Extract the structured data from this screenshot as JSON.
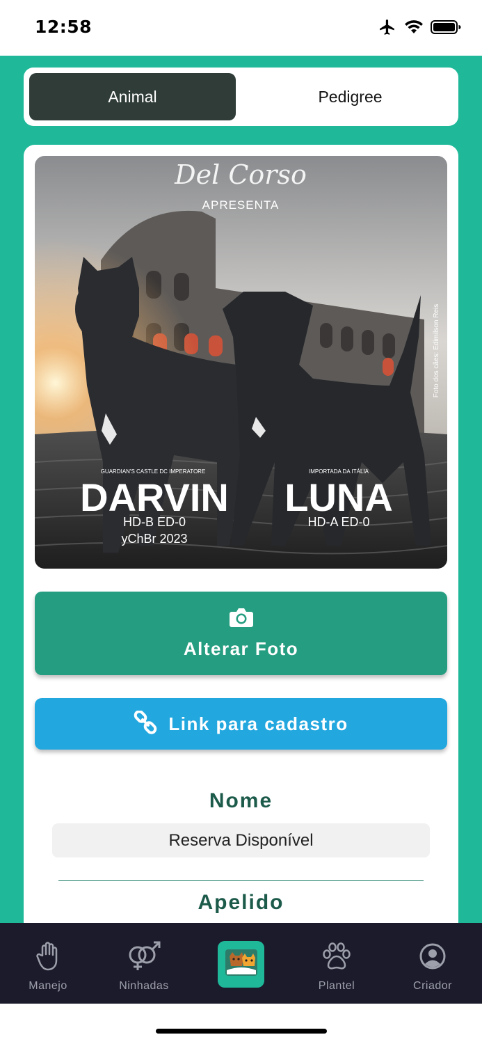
{
  "status_bar": {
    "time": "12:58",
    "icons": [
      "airplane-icon",
      "wifi-icon",
      "battery-icon"
    ]
  },
  "tabs": {
    "items": [
      {
        "label": "Animal",
        "active": true
      },
      {
        "label": "Pedigree",
        "active": false
      }
    ]
  },
  "photo": {
    "header_text": "Del Corso",
    "subheader": "APRESENTA",
    "credit": "Foto dos cães: Edimilson Reis",
    "dog_left": {
      "kennel": "GUARDIAN'S CASTLE DC IMPERATORE",
      "name": "DARVIN",
      "info_1": "HD-B  ED-0",
      "info_2": "yChBr 2023"
    },
    "dog_right": {
      "origin": "IMPORTADA DA ITÁLIA",
      "name": "LUNA",
      "info_1": "HD-A  ED-0"
    }
  },
  "actions": {
    "change_photo_label": "Alterar Foto",
    "change_photo_icon": "camera-icon",
    "link_label": "Link para cadastro",
    "link_icon": "link-icon"
  },
  "form": {
    "name_label": "Nome",
    "name_value": "Reserva Disponível",
    "nickname_label": "Apelido"
  },
  "bottom_nav": {
    "items": [
      {
        "label": "Manejo",
        "icon": "hand-icon"
      },
      {
        "label": "Ninhadas",
        "icon": "gender-icon"
      },
      {
        "label": "",
        "icon": "pets-app-icon",
        "active": true
      },
      {
        "label": "Plantel",
        "icon": "paw-icon"
      },
      {
        "label": "Criador",
        "icon": "user-icon"
      }
    ]
  },
  "colors": {
    "primary_green": "#1fb99a",
    "button_green": "#259d80",
    "button_blue": "#23a7df",
    "tab_active": "#2f3c37",
    "nav_background": "#1c1b2c",
    "label_text": "#1c5a4a"
  }
}
